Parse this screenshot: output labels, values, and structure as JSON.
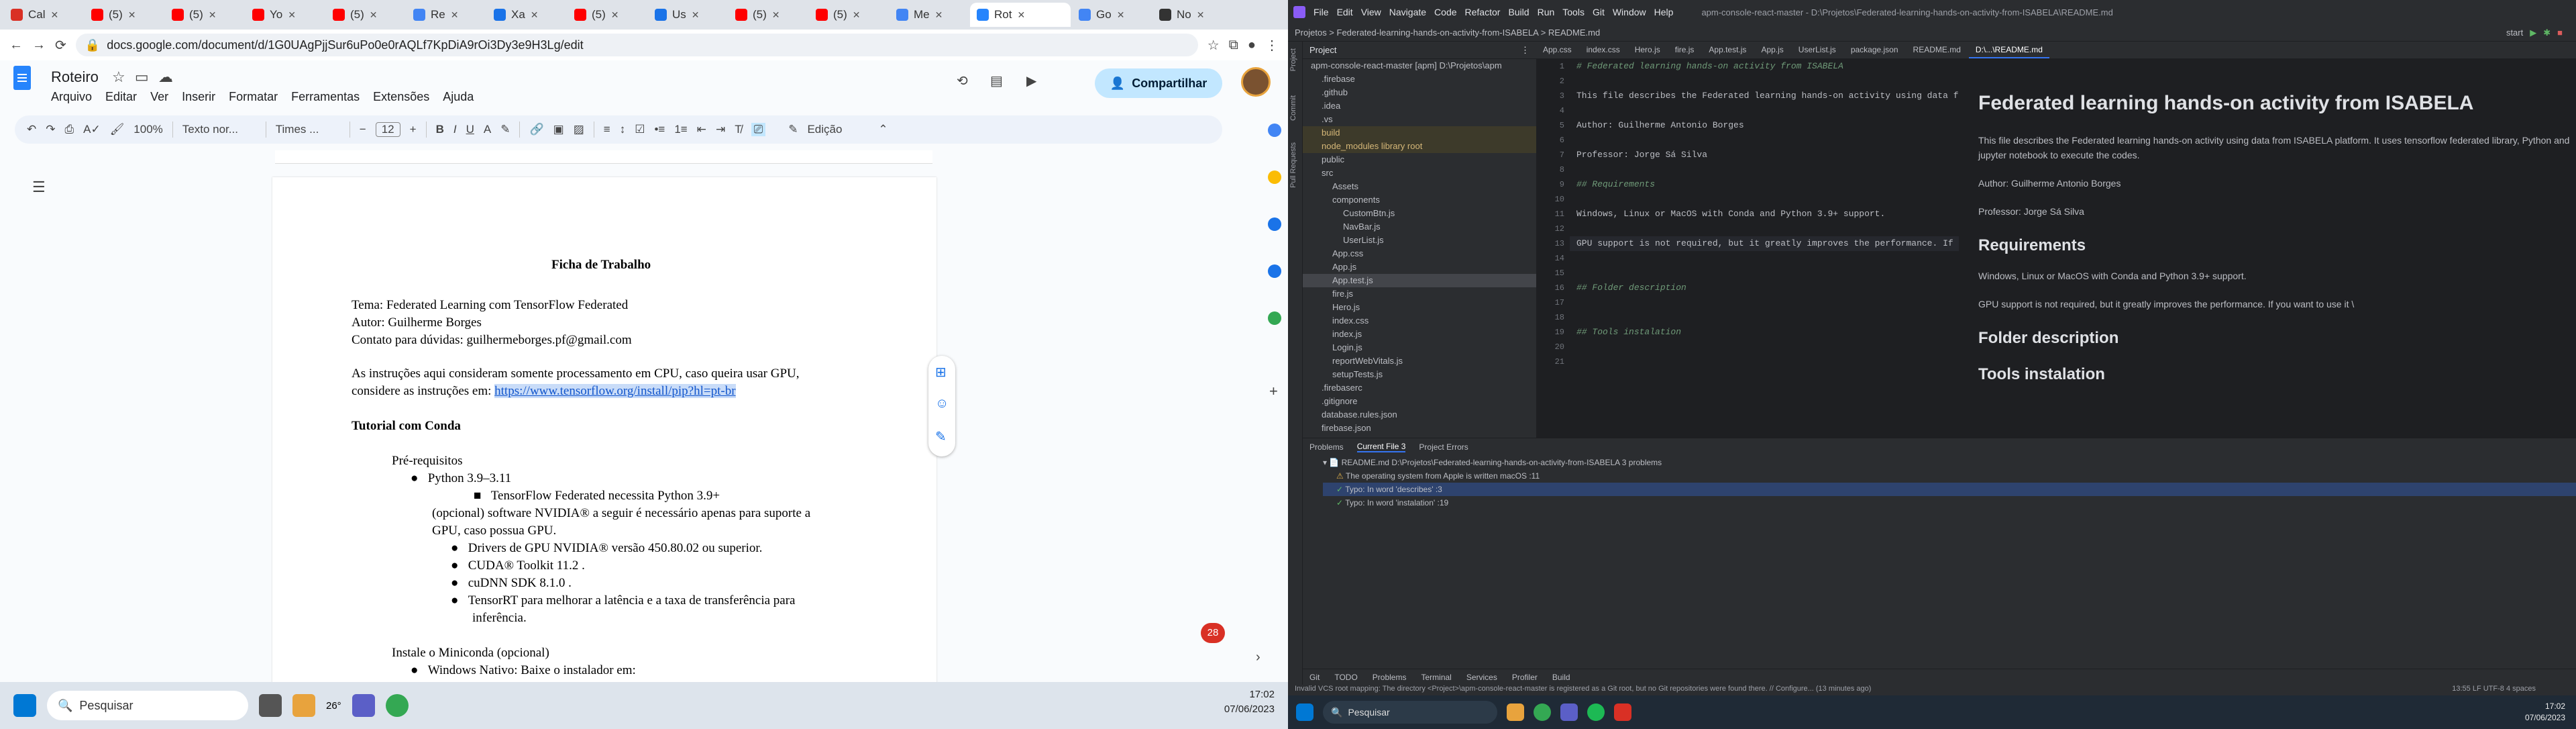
{
  "left_window": {
    "tabs": [
      {
        "label": "Cal",
        "color": "#d93025"
      },
      {
        "label": "(5)",
        "color": "#ff0000"
      },
      {
        "label": "(5)",
        "color": "#ff0000"
      },
      {
        "label": "Yo",
        "color": "#ff0000"
      },
      {
        "label": "(5)",
        "color": "#ff0000"
      },
      {
        "label": "Re",
        "color": "#4285f4"
      },
      {
        "label": "Xa",
        "color": "#1a73e8"
      },
      {
        "label": "(5)",
        "color": "#ff0000"
      },
      {
        "label": "Us",
        "color": "#1a73e8"
      },
      {
        "label": "(5)",
        "color": "#ff0000"
      },
      {
        "label": "(5)",
        "color": "#ff0000"
      },
      {
        "label": "Me",
        "color": "#4285f4"
      },
      {
        "label": "Rot",
        "color": "#2684fc"
      },
      {
        "label": "Go",
        "color": "#4285f4"
      },
      {
        "label": "No",
        "color": "#333333"
      }
    ],
    "url": "docs.google.com/document/d/1G0UAgPjjSur6uPo0e0rAQLf7KpDiA9rOi3Dy3e9H3Lg/edit",
    "doc": {
      "title": "Roteiro",
      "menus": [
        "Arquivo",
        "Editar",
        "Ver",
        "Inserir",
        "Formatar",
        "Ferramentas",
        "Extensões",
        "Ajuda"
      ],
      "share_label": "Compartilhar",
      "zoom": "100%",
      "style": "Texto nor...",
      "font": "Times ...",
      "size": "12",
      "mode": "Edição",
      "content": {
        "heading": "Ficha de Trabalho",
        "line1": "Tema: Federated Learning com TensorFlow Federated",
        "line2": "Autor: Guilherme Borges",
        "line3": "Contato para dúvidas: guilhermeborges.pf@gmail.com",
        "line4": "As instruções aqui consideram somente processamento em CPU, caso queira usar GPU,",
        "line5": "considere as instruções em:",
        "link": "https://www.tensorflow.org/install/pip?hl=pt-br",
        "section": "Tutorial com Conda",
        "prereq": "Pré-requisitos",
        "b1": "Python 3.9–3.11",
        "b1a": "TensorFlow Federated necessita Python 3.9+",
        "p1": "(opcional) software NVIDIA® a seguir é necessário apenas para suporte a",
        "p2": "GPU, caso possua GPU.",
        "c1": "Drivers de GPU NVIDIA® versão 450.80.02 ou superior.",
        "c2": "CUDA® Toolkit 11.2 .",
        "c3": "cuDNN SDK 8.1.0 .",
        "c4": "TensorRT para melhorar a latência e a taxa de transferência para",
        "c4b": "inferência.",
        "install": "Instale o Miniconda (opcional)",
        "win": "Windows Nativo: Baixe o instalador em:"
      },
      "badge": "28"
    },
    "taskbar": {
      "search": "Pesquisar",
      "temp": "26°",
      "time": "17:02",
      "date": "07/06/2023"
    }
  },
  "right_window": {
    "menu": [
      "File",
      "Edit",
      "View",
      "Navigate",
      "Code",
      "Refactor",
      "Build",
      "Run",
      "Tools",
      "Git",
      "Window",
      "Help"
    ],
    "project_title": "apm-console-react-master - D:\\Projetos\\Federated-learning-hands-on-activity-from-ISABELA\\README.md",
    "breadcrumb": "Projetos  >  Federated-learning-hands-on-activity-from-ISABELA  >  README.md",
    "run_config": "start",
    "project_label": "Project",
    "tree": [
      "apm-console-react-master [apm]  D:\\Projetos\\apm",
      ".firebase",
      ".github",
      ".idea",
      ".vs",
      "build",
      "node_modules  library root",
      "public",
      "src",
      "Assets",
      "components",
      "CustomBtn.js",
      "NavBar.js",
      "UserList.js",
      "App.css",
      "App.js",
      "App.test.js",
      "fire.js",
      "Hero.js",
      "index.css",
      "index.js",
      "Login.js",
      "reportWebVitals.js",
      "setupTests.js",
      ".firebaserc",
      ".gitignore",
      "database.rules.json",
      "firebase.json"
    ],
    "editor_tabs": [
      "App.css",
      "index.css",
      "Hero.js",
      "fire.js",
      "App.test.js",
      "App.js",
      "UserList.js",
      "package.json",
      "README.md",
      "D:\\...\\README.md"
    ],
    "code_lines": [
      "# Federated learning hands-on activity from ISABELA",
      "",
      "This file describes the Federated learning hands-on activity using data from ISABELA platform. It uses",
      "",
      "Author: Guilherme Antonio Borges",
      "",
      "Professor: Jorge Sá Silva",
      "",
      "## Requirements",
      "",
      "Windows, Linux or MacOS with Conda and Python 3.9+ support.",
      "",
      "GPU support is not required, but it greatly improves the performance. If you want to use it \\\\",
      "",
      "",
      "## Folder description",
      "",
      "",
      "## Tools instalation",
      "",
      ""
    ],
    "preview": {
      "h1": "Federated learning hands-on activity from ISABELA",
      "p1": "This file describes the Federated learning hands-on activity using data from ISABELA platform. It uses tensorflow federated library, Python and jupyter notebook to execute the codes.",
      "p2": "Author: Guilherme Antonio Borges",
      "p3": "Professor: Jorge Sá Silva",
      "h2a": "Requirements",
      "p4": "Windows, Linux or MacOS with Conda and Python 3.9+ support.",
      "p5": "GPU support is not required, but it greatly improves the performance. If you want to use it \\",
      "h2b": "Folder description",
      "h2c": "Tools instalation"
    },
    "problems": {
      "tabs": [
        "Problems",
        "Current File 3",
        "Project Errors"
      ],
      "file": "README.md  D:\\Projetos\\Federated-learning-hands-on-activity-from-ISABELA  3 problems",
      "items": [
        "The operating system from Apple is written macOS  :11",
        "Typo: In word 'describes'  :3",
        "Typo: In word 'instalation'  :19"
      ]
    },
    "bottom_tabs": [
      "Git",
      "TODO",
      "Problems",
      "Terminal",
      "Services",
      "Profiler",
      "Build"
    ],
    "status": "Invalid VCS root mapping: The directory <Project>\\apm-console-react-master is registered as a Git root, but no Git repositories were found there. // Configure... (13 minutes ago)",
    "status_right": "13:55   LF   UTF-8   4 spaces",
    "taskbar": {
      "search": "Pesquisar",
      "time": "17:02",
      "date": "07/06/2023"
    }
  }
}
